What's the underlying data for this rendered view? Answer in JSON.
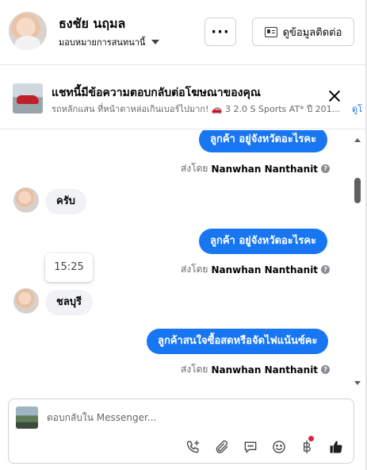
{
  "header": {
    "name": "ธงชัย นฤมล",
    "assign_label": "มอบหมายการสนทนานี้",
    "more_label": "···",
    "contact_label": "ดูข้อมูลติดต่อ"
  },
  "ad": {
    "title": "แชทนี้มีข้อความตอบกลับต่อโฆษณาของคุณ",
    "subtitle": "รถหลักแสน ที่หน้าตาหล่อเกินเบอร์ไปมาก! 🚗 3 2.0 S Sports AT* ปี 201...",
    "link": "ดูโ"
  },
  "thread": {
    "messages": [
      {
        "type": "out",
        "text": "ลูกค้า  อยู่จังหวัดอะไรคะ"
      },
      {
        "type": "sent_by",
        "prefix": "ส่งโดย",
        "agent": "Nanwhan Nanthanit"
      },
      {
        "type": "in",
        "text": "ครับ"
      },
      {
        "type": "out",
        "text": "ลูกค้า  อยู่จังหวัดอะไรคะ"
      },
      {
        "type": "sent_by",
        "prefix": "ส่งโดย",
        "agent": "Nanwhan Nanthanit"
      },
      {
        "type": "in",
        "text": "ชลบุรี"
      },
      {
        "type": "out",
        "text": "ลูกค้าสนใจซื้อสดหรือจัดไฟแน้นซ์คะ"
      },
      {
        "type": "sent_by",
        "prefix": "ส่งโดย",
        "agent": "Nanwhan Nanthanit"
      }
    ],
    "timestamp": "15:25",
    "info_glyph": "?"
  },
  "composer": {
    "placeholder": "ตอบกลับใน Messenger...",
    "tools": [
      "call-add-icon",
      "attachment-icon",
      "saved-reply-icon",
      "emoji-icon",
      "baht-payment-icon",
      "like-icon"
    ],
    "colors": {
      "accent": "#1876f2",
      "badge": "#e41e3f"
    }
  }
}
